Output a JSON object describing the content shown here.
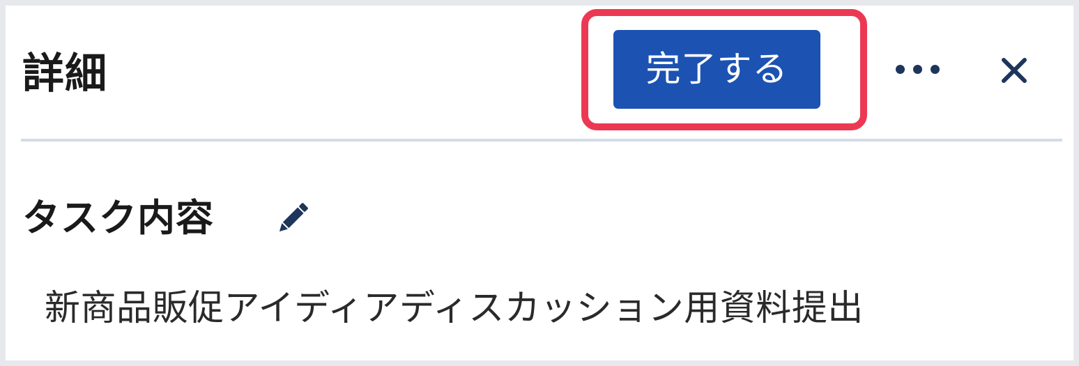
{
  "header": {
    "title": "詳細",
    "complete_label": "完了する",
    "more_icon": "more-horizontal-icon",
    "close_icon": "close-icon"
  },
  "task": {
    "section_title": "タスク内容",
    "edit_icon": "pencil-icon",
    "content": "新商品販促アイディアディスカッション用資料提出"
  },
  "colors": {
    "primary_button": "#1c52b2",
    "highlight_border": "#ec3953",
    "icon": "#1e355c",
    "divider": "#d3dbe9"
  }
}
